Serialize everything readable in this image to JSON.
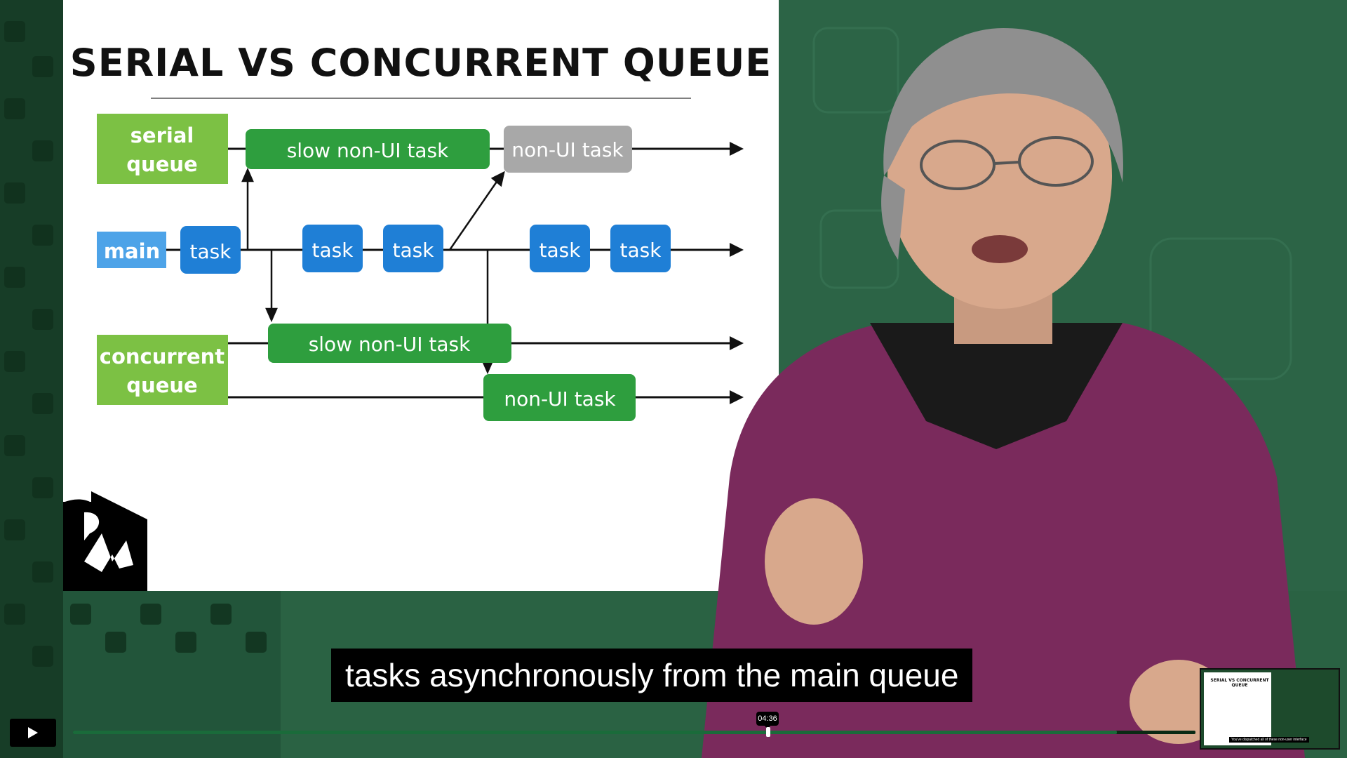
{
  "slide": {
    "title": "SERIAL VS CONCURRENT QUEUE",
    "serial_queue_label_line1": "serial",
    "serial_queue_label_line2": "queue",
    "main_label": "main",
    "concurrent_queue_label_line1": "concurrent",
    "concurrent_queue_label_line2": "queue",
    "serial_task_1": "slow non-UI task",
    "serial_task_2": "non-UI task",
    "main_tasks": [
      "task",
      "task",
      "task",
      "task",
      "task"
    ],
    "concurrent_task_1": "slow non-UI task",
    "concurrent_task_2": "non-UI task",
    "colors": {
      "queue_label_green": "#7cc144",
      "main_label_blue": "#4da3e8",
      "task_green": "#2e9e3e",
      "task_gray": "#a8a8a8",
      "task_blue": "#1f7fd6"
    }
  },
  "video": {
    "caption": "tasks asynchronously from the main queue",
    "hover_time": "04:36",
    "progress_fraction": 0.93,
    "play_icon": "play-icon"
  },
  "thumbnail": {
    "title": "SERIAL VS CONCURRENT QUEUE",
    "caption": "You've dispatched all of these non-user interface"
  }
}
